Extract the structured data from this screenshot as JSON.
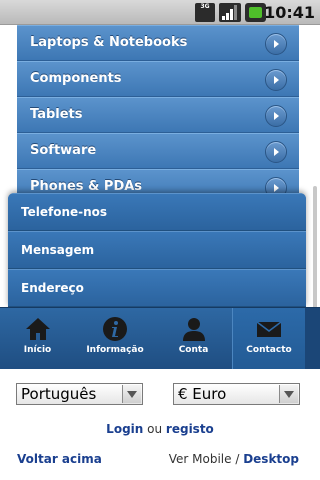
{
  "status_bar": {
    "network": "3G",
    "time": "10:41"
  },
  "categories": [
    {
      "label": "Laptops & Notebooks"
    },
    {
      "label": "Components"
    },
    {
      "label": "Tablets"
    },
    {
      "label": "Software"
    },
    {
      "label": "Phones & PDAs"
    }
  ],
  "contact_menu": {
    "items": [
      {
        "label": "Telefone-nos"
      },
      {
        "label": "Mensagem"
      },
      {
        "label": "Endereço"
      }
    ]
  },
  "tabs": [
    {
      "label": "Início",
      "icon": "home-icon"
    },
    {
      "label": "Informação",
      "icon": "info-icon"
    },
    {
      "label": "Conta",
      "icon": "user-icon"
    },
    {
      "label": "Contacto",
      "icon": "mail-icon",
      "active": true
    }
  ],
  "footer": {
    "language_select": {
      "value": "Português"
    },
    "currency_select": {
      "value": "€ Euro"
    },
    "login_label": "Login",
    "or_text": "ou",
    "register_label": "registo",
    "back_to_top": "Voltar acima",
    "view_text": "Ver Mobile /",
    "desktop_label": "Desktop"
  },
  "colors": {
    "bar_blue": "#3d77b4",
    "tabbar_blue": "#2e68a3",
    "link_blue": "#1a3f8f"
  }
}
